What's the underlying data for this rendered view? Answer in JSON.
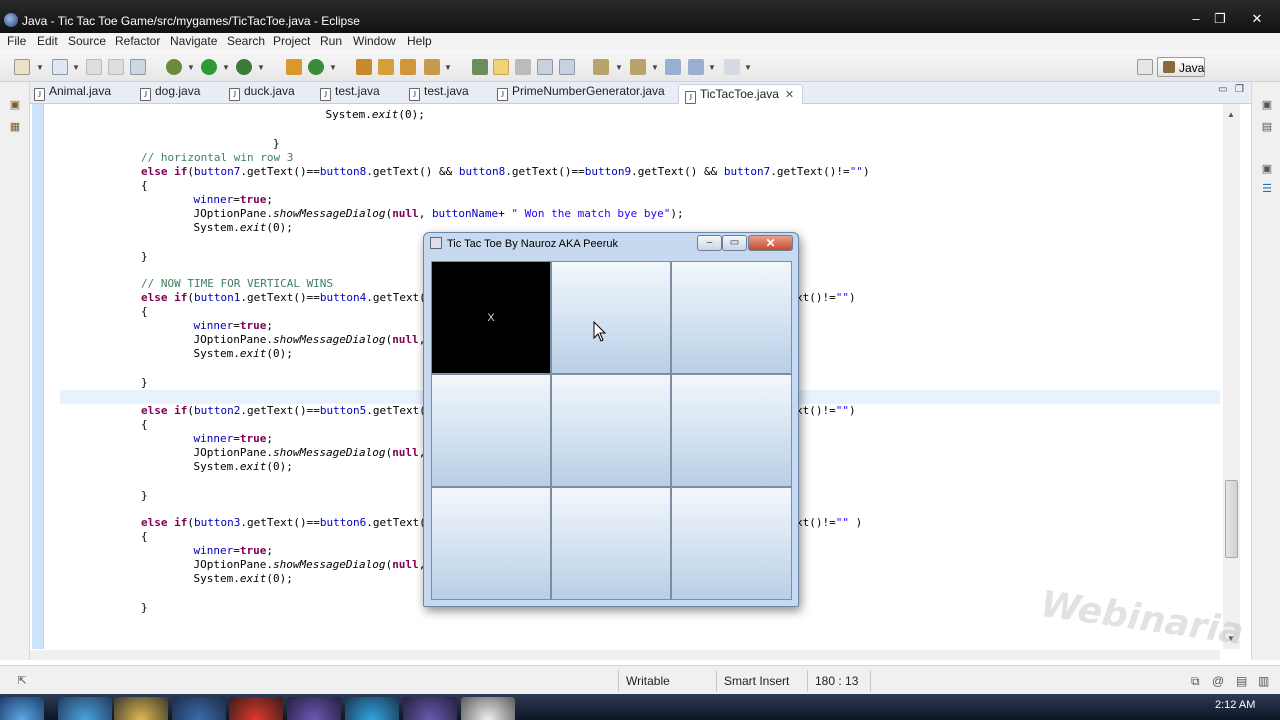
{
  "window": {
    "title": "Java - Tic Tac Toe Game/src/mygames/TicTacToe.java - Eclipse",
    "minimize": "–",
    "maximize": "❐",
    "close": "✕"
  },
  "menu": [
    "File",
    "Edit",
    "Source",
    "Refactor",
    "Navigate",
    "Search",
    "Project",
    "Run",
    "Window",
    "Help"
  ],
  "perspective": {
    "label": "Java"
  },
  "tabs": [
    {
      "label": "Animal.java",
      "active": false
    },
    {
      "label": "dog.java",
      "active": false
    },
    {
      "label": "duck.java",
      "active": false
    },
    {
      "label": "test.java",
      "active": false
    },
    {
      "label": "test.java",
      "active": false
    },
    {
      "label": "PrimeNumberGenerator.java",
      "active": false
    },
    {
      "label": "TicTacToe.java",
      "active": true
    }
  ],
  "code": [
    {
      "parts": [
        {
          "t": "            System."
        },
        {
          "t": "exit",
          "c": "c-it"
        },
        {
          "t": "(0);"
        }
      ]
    },
    {
      "parts": [
        {
          "t": "        }"
        }
      ]
    },
    {
      "parts": [
        {
          "t": "// horizontal win row 3",
          "c": "c-com"
        }
      ]
    },
    {
      "parts": [
        {
          "t": "else",
          "c": "c-kw"
        },
        {
          "t": " "
        },
        {
          "t": "if",
          "c": "c-kw"
        },
        {
          "t": "("
        },
        {
          "t": "button7",
          "c": "c-fld"
        },
        {
          "t": ".getText()=="
        },
        {
          "t": "button8",
          "c": "c-fld"
        },
        {
          "t": ".getText() && "
        },
        {
          "t": "button8",
          "c": "c-fld"
        },
        {
          "t": ".getText()=="
        },
        {
          "t": "button9",
          "c": "c-fld"
        },
        {
          "t": ".getText() && "
        },
        {
          "t": "button7",
          "c": "c-fld"
        },
        {
          "t": ".getText()!="
        },
        {
          "t": "\"\"",
          "c": "c-str"
        },
        {
          "t": ")"
        }
      ]
    },
    {
      "parts": [
        {
          "t": "{"
        }
      ]
    },
    {
      "parts": [
        {
          "t": "    "
        },
        {
          "t": "winner",
          "c": "c-fld"
        },
        {
          "t": "="
        },
        {
          "t": "true",
          "c": "c-kw"
        },
        {
          "t": ";"
        }
      ]
    },
    {
      "parts": [
        {
          "t": "    JOptionPane."
        },
        {
          "t": "showMessageDialog",
          "c": "c-it"
        },
        {
          "t": "("
        },
        {
          "t": "null",
          "c": "c-kw"
        },
        {
          "t": ", "
        },
        {
          "t": "buttonName",
          "c": "c-fld"
        },
        {
          "t": "+ "
        },
        {
          "t": "\" Won the match bye bye\"",
          "c": "c-str"
        },
        {
          "t": ");"
        }
      ]
    },
    {
      "parts": [
        {
          "t": "    System."
        },
        {
          "t": "exit",
          "c": "c-it"
        },
        {
          "t": "(0);"
        }
      ]
    },
    {
      "parts": [
        {
          "t": "}"
        }
      ]
    },
    {
      "parts": [
        {
          "t": "// NOW TIME FOR VERTICAL WINS",
          "c": "c-com"
        }
      ]
    },
    {
      "parts": [
        {
          "t": "else",
          "c": "c-kw"
        },
        {
          "t": " "
        },
        {
          "t": "if",
          "c": "c-kw"
        },
        {
          "t": "("
        },
        {
          "t": "button1",
          "c": "c-fld"
        },
        {
          "t": ".getText()=="
        },
        {
          "t": "button4",
          "c": "c-fld"
        },
        {
          "t": ".getText("
        }
      ]
    },
    {
      "parts": [
        {
          "t": "{"
        }
      ]
    },
    {
      "parts": [
        {
          "t": "    "
        },
        {
          "t": "winner",
          "c": "c-fld"
        },
        {
          "t": "="
        },
        {
          "t": "true",
          "c": "c-kw"
        },
        {
          "t": ";"
        }
      ]
    },
    {
      "parts": [
        {
          "t": "    JOptionPane."
        },
        {
          "t": "showMessageDialog",
          "c": "c-it"
        },
        {
          "t": "("
        },
        {
          "t": "null",
          "c": "c-kw"
        },
        {
          "t": ", "
        },
        {
          "t": "but",
          "c": "c-fld"
        }
      ]
    },
    {
      "parts": [
        {
          "t": "    System."
        },
        {
          "t": "exit",
          "c": "c-it"
        },
        {
          "t": "(0);"
        }
      ]
    },
    {
      "parts": [
        {
          "t": "}"
        }
      ]
    },
    {
      "parts": [
        {
          "t": "else",
          "c": "c-kw"
        },
        {
          "t": " "
        },
        {
          "t": "if",
          "c": "c-kw"
        },
        {
          "t": "("
        },
        {
          "t": "button2",
          "c": "c-fld"
        },
        {
          "t": ".getText()=="
        },
        {
          "t": "button5",
          "c": "c-fld"
        },
        {
          "t": ".getText("
        }
      ]
    },
    {
      "parts": [
        {
          "t": "{"
        }
      ]
    },
    {
      "parts": [
        {
          "t": "    "
        },
        {
          "t": "winner",
          "c": "c-fld"
        },
        {
          "t": "="
        },
        {
          "t": "true",
          "c": "c-kw"
        },
        {
          "t": ";"
        }
      ]
    },
    {
      "parts": [
        {
          "t": "    JOptionPane."
        },
        {
          "t": "showMessageDialog",
          "c": "c-it"
        },
        {
          "t": "("
        },
        {
          "t": "null",
          "c": "c-kw"
        },
        {
          "t": ", "
        },
        {
          "t": "but",
          "c": "c-fld"
        }
      ]
    },
    {
      "parts": [
        {
          "t": "    System."
        },
        {
          "t": "exit",
          "c": "c-it"
        },
        {
          "t": "(0);"
        }
      ]
    },
    {
      "parts": [
        {
          "t": "}"
        }
      ]
    },
    {
      "parts": [
        {
          "t": "else",
          "c": "c-kw"
        },
        {
          "t": " "
        },
        {
          "t": "if",
          "c": "c-kw"
        },
        {
          "t": "("
        },
        {
          "t": "button3",
          "c": "c-fld"
        },
        {
          "t": ".getText()=="
        },
        {
          "t": "button6",
          "c": "c-fld"
        },
        {
          "t": ".getText("
        }
      ]
    },
    {
      "parts": [
        {
          "t": "{"
        }
      ]
    },
    {
      "parts": [
        {
          "t": "    "
        },
        {
          "t": "winner",
          "c": "c-fld"
        },
        {
          "t": "="
        },
        {
          "t": "true",
          "c": "c-kw"
        },
        {
          "t": ";"
        }
      ]
    },
    {
      "parts": [
        {
          "t": "    JOptionPane."
        },
        {
          "t": "showMessageDialog",
          "c": "c-it"
        },
        {
          "t": "("
        },
        {
          "t": "null",
          "c": "c-kw"
        },
        {
          "t": ", "
        },
        {
          "t": "but",
          "c": "c-fld"
        }
      ]
    },
    {
      "parts": [
        {
          "t": "    System."
        },
        {
          "t": "exit",
          "c": "c-it"
        },
        {
          "t": "(0);"
        }
      ]
    },
    {
      "parts": [
        {
          "t": "}"
        }
      ]
    }
  ],
  "code_tails": [
    {
      "parts": [
        {
          "t": "xt()!="
        },
        {
          "t": "\"\"",
          "c": "c-str"
        },
        {
          "t": ")"
        }
      ]
    },
    {
      "parts": [
        {
          "t": "xt()!="
        },
        {
          "t": "\"\"",
          "c": "c-str"
        },
        {
          "t": ")"
        }
      ]
    },
    {
      "parts": [
        {
          "t": "xt()!="
        },
        {
          "t": "\"\"",
          "c": "c-str"
        },
        {
          "t": " )"
        }
      ]
    }
  ],
  "dialog": {
    "title": "Tic Tac Toe By Nauroz AKA Peeruk",
    "cells": [
      "X",
      "",
      "",
      "",
      "",
      "",
      "",
      "",
      ""
    ]
  },
  "status": {
    "writable": "Writable",
    "insert_mode": "Smart Insert",
    "position": "180 : 13"
  },
  "taskbar": {
    "clock": "2:12 AM"
  },
  "watermark": "Webinaria"
}
